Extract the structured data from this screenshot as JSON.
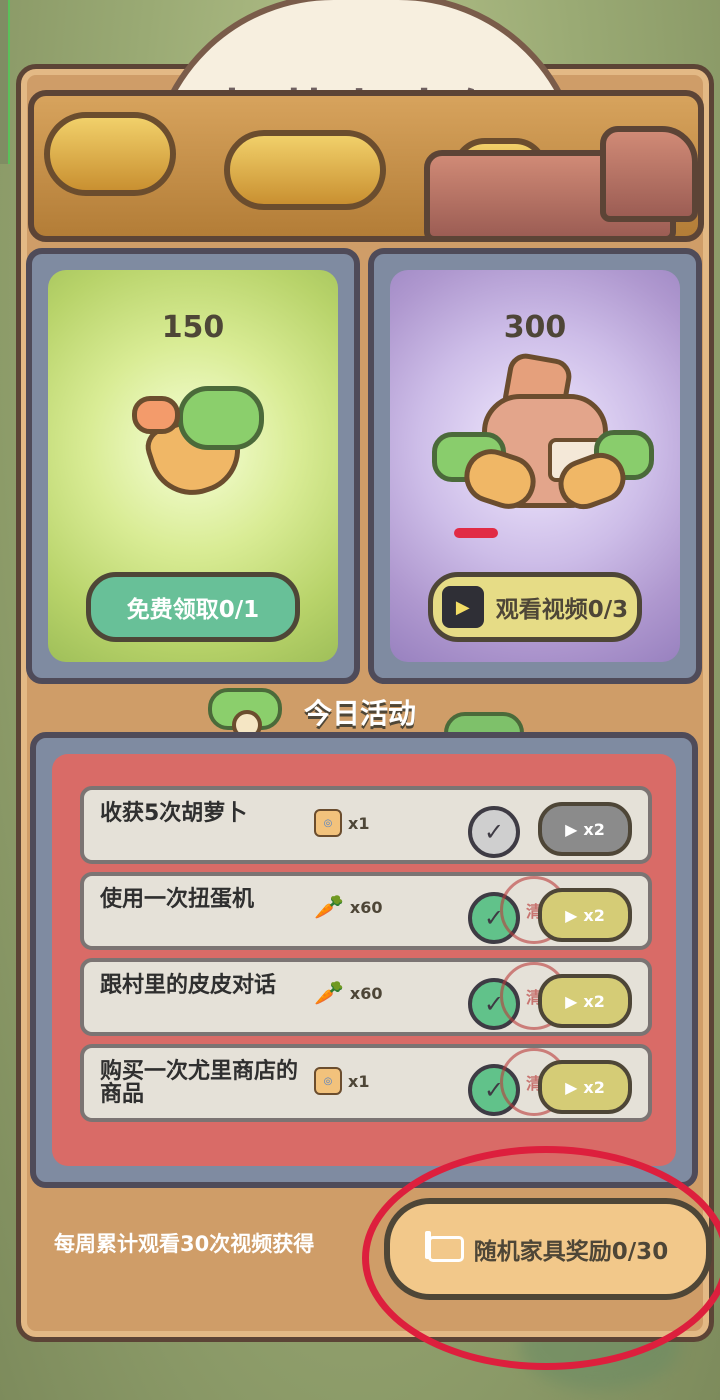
{
  "title": "胡萝卜大促",
  "cards": [
    {
      "value": "150",
      "button": "免费领取0/1"
    },
    {
      "value": "300",
      "button": "观看视频0/3"
    }
  ],
  "activity": {
    "title": "今日活动",
    "tasks": [
      {
        "text": "收获5次胡萝卜",
        "reward": "x1",
        "multiplier": "x2",
        "status": "pending"
      },
      {
        "text": "使用一次扭蛋机",
        "reward": "x60",
        "multiplier": "x2",
        "status": "completed",
        "seal": "清"
      },
      {
        "text": "跟村里的皮皮对话",
        "reward": "x60",
        "multiplier": "x2",
        "status": "completed",
        "seal": "清"
      },
      {
        "text": "购买一次尤里商店的商品",
        "reward": "x1",
        "multiplier": "x2",
        "status": "completed",
        "seal": "清"
      }
    ]
  },
  "weekly": {
    "text": "每周累计观看30次视频获得",
    "button": "随机家具奖励0/30"
  }
}
